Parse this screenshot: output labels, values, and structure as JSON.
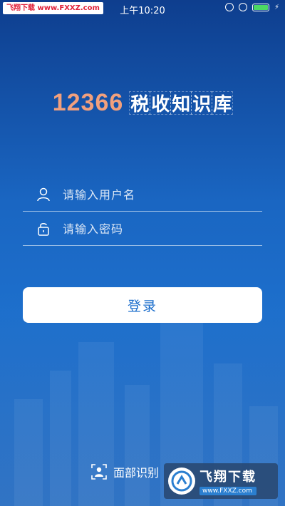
{
  "status_bar": {
    "time": "上午10:20",
    "watermark_site": "飞翔下载",
    "watermark_url": "www.FXXZ.com",
    "icons": [
      "rotation-lock-icon",
      "alarm-icon",
      "battery-icon",
      "charging-icon"
    ]
  },
  "logo": {
    "number": "12366",
    "chars": [
      "税",
      "收",
      "知",
      "识",
      "库"
    ]
  },
  "login_form": {
    "username_placeholder": "请输入用户名",
    "password_placeholder": "请输入密码",
    "login_label": "登录"
  },
  "face_recognition": {
    "label": "面部识别"
  },
  "watermark": {
    "title": "飞翔下载",
    "url": "www.FXXZ.com"
  },
  "colors": {
    "background_top": "#0e3e8e",
    "background_mid": "#1d6fcc",
    "logo_number": "#f2a07d",
    "button_text": "#1d6fcc"
  }
}
